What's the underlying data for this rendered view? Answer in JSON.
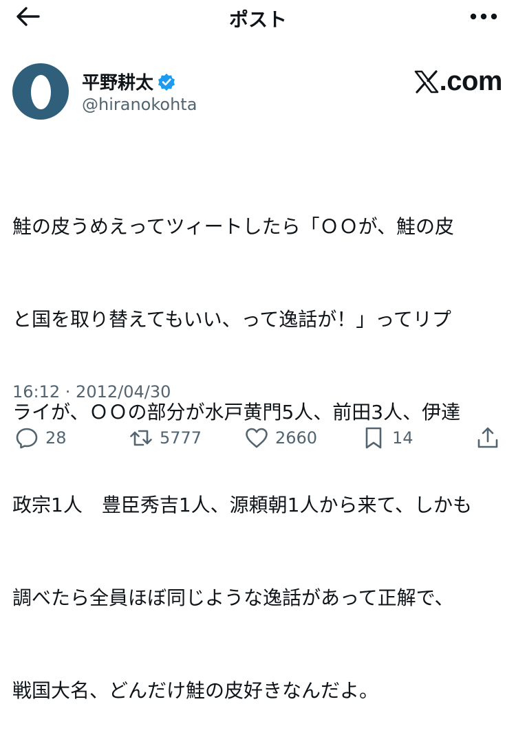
{
  "header": {
    "title": "ポスト",
    "back_icon": "arrow-left-icon",
    "more_icon": "more-horizontal-icon"
  },
  "author": {
    "name": "平野耕太",
    "handle": "@hiranokohta",
    "verified": true,
    "avatar": "default-egg-avatar",
    "avatar_color": "#2f5f7b",
    "verified_color": "#1d9bf0"
  },
  "branding": {
    "domain": ".com",
    "logo_icon": "x-logo-icon"
  },
  "post": {
    "lines": [
      "鮭の皮うめえってツィートしたら「ＯＯが、鮭の皮",
      "と国を取り替えてもいい、って逸話が！」ってリプ",
      "ライが、ＯＯの部分が水戸黄門5人、前田3人、伊達",
      "政宗1人　豊臣秀吉1人、源頼朝1人から来て、しかも",
      "調べたら全員ほぼ同じような逸話があって正解で、",
      "戦国大名、どんだけ鮭の皮好きなんだよ。"
    ],
    "timestamp": "16:12 · 2012/04/30"
  },
  "actions": {
    "reply_count": "28",
    "repost_count": "5777",
    "like_count": "2660",
    "bookmark_count": "14"
  },
  "colors": {
    "text": "#0f1419",
    "secondary": "#536471",
    "accent": "#1d9bf0"
  }
}
